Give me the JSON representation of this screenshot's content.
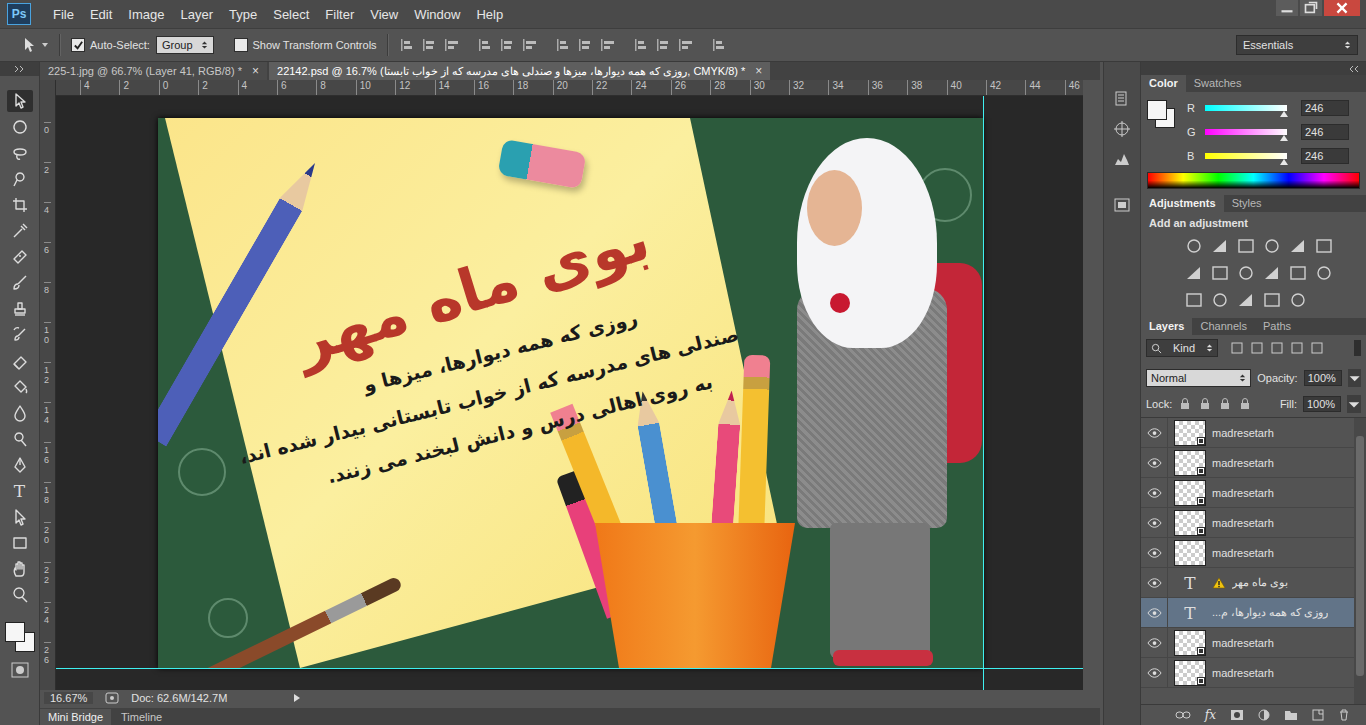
{
  "app": {
    "logo": "Ps"
  },
  "menu": [
    "File",
    "Edit",
    "Image",
    "Layer",
    "Type",
    "Select",
    "Filter",
    "View",
    "Window",
    "Help"
  ],
  "options_bar": {
    "auto_select": {
      "label": "Auto-Select:",
      "checked": true
    },
    "target": "Group",
    "transform_controls": {
      "label": "Show Transform Controls",
      "checked": false
    },
    "workspace": "Essentials"
  },
  "document_tabs": [
    {
      "label": "225-1.jpg @ 66.7% (Layer 41, RGB/8) *",
      "close": "×",
      "selected": false
    },
    {
      "label": "22142.psd @ 16.7% (روزی که همه دیوارها، میزها و  صندلی های مدرسه که از خواب تابستا, CMYK/8) *",
      "close": "×",
      "selected": true
    }
  ],
  "tools": [
    {
      "kind": "move",
      "selected": true
    },
    {
      "kind": "marquee",
      "selected": false
    },
    {
      "kind": "lasso",
      "selected": false
    },
    {
      "kind": "quick-select",
      "selected": false
    },
    {
      "kind": "crop",
      "selected": false
    },
    {
      "kind": "eyedropper",
      "selected": false
    },
    {
      "kind": "heal",
      "selected": false
    },
    {
      "kind": "brush",
      "selected": false
    },
    {
      "kind": "stamp",
      "selected": false
    },
    {
      "kind": "history",
      "selected": false
    },
    {
      "kind": "eraser",
      "selected": false
    },
    {
      "kind": "bucket",
      "selected": false
    },
    {
      "kind": "blur",
      "selected": false
    },
    {
      "kind": "dodge",
      "selected": false
    },
    {
      "kind": "pen",
      "selected": false
    },
    {
      "kind": "type",
      "label": "T",
      "selected": false
    },
    {
      "kind": "path-select",
      "selected": false
    },
    {
      "kind": "shape",
      "selected": false
    },
    {
      "kind": "hand",
      "selected": false
    },
    {
      "kind": "zoom",
      "selected": false
    }
  ],
  "rulers": {
    "top": [
      "4",
      "2",
      "0",
      "2",
      "4",
      "6",
      "8",
      "10",
      "12",
      "14",
      "16",
      "18",
      "20",
      "22",
      "24",
      "26",
      "28",
      "30",
      "32",
      "34",
      "36",
      "38",
      "40",
      "42",
      "44",
      "46"
    ],
    "left": [
      "0",
      "2",
      "4",
      "6",
      "8",
      "10",
      "12",
      "14",
      "16",
      "18",
      "20",
      "22",
      "24",
      "26"
    ]
  },
  "poster": {
    "title": "بوی ماه مهر",
    "lines": [
      "روزی که همه دیوارها، میزها و",
      "صندلی های مدرسه که از خواب تابستانی بیدار شده اند،",
      "به روی اهالی درس و دانش لبخند می زنند."
    ]
  },
  "status_bar": {
    "zoom": "16.67%",
    "doc": "Doc: 62.6M/142.7M"
  },
  "bottom_tabs": [
    {
      "label": "Mini Bridge",
      "selected": true
    },
    {
      "label": "Timeline",
      "selected": false
    }
  ],
  "color_panel": {
    "tabs": [
      {
        "label": "Color",
        "selected": true
      },
      {
        "label": "Swatches",
        "selected": false
      }
    ],
    "channels": [
      {
        "name": "R",
        "value": "246",
        "level": 0.965,
        "color": "#00ffff"
      },
      {
        "name": "G",
        "value": "246",
        "level": 0.965,
        "color": "#ff00ff"
      },
      {
        "name": "B",
        "value": "246",
        "level": 0.965,
        "color": "#ffff00"
      }
    ]
  },
  "adjustments_panel": {
    "tabs": [
      {
        "label": "Adjustments",
        "selected": true
      },
      {
        "label": "Styles",
        "selected": false
      }
    ],
    "hint": "Add an adjustment"
  },
  "layers_panel": {
    "tabs": [
      {
        "label": "Layers",
        "selected": true
      },
      {
        "label": "Channels",
        "selected": false
      },
      {
        "label": "Paths",
        "selected": false
      }
    ],
    "filter": "Kind",
    "blend_mode": "Normal",
    "opacity_label": "Opacity:",
    "opacity": "100%",
    "lock_label": "Lock:",
    "fill_label": "Fill:",
    "fill": "100%",
    "fx": "fx",
    "layers": [
      {
        "name": "madresetarh",
        "kind": "smart",
        "visible": true,
        "selected": false,
        "warning": false
      },
      {
        "name": "madresetarh",
        "kind": "smart",
        "visible": true,
        "selected": false,
        "warning": false
      },
      {
        "name": "madresetarh",
        "kind": "smart",
        "visible": true,
        "selected": false,
        "warning": false
      },
      {
        "name": "madresetarh",
        "kind": "smart",
        "visible": true,
        "selected": false,
        "warning": false
      },
      {
        "name": "madresetarh",
        "kind": "raster",
        "visible": true,
        "selected": false,
        "warning": false
      },
      {
        "name": "بوی ماه مهر",
        "kind": "text",
        "thumb": "T",
        "visible": true,
        "selected": false,
        "warning": true
      },
      {
        "name": "روزی که همه دیوارها، م...",
        "kind": "text",
        "thumb": "T",
        "visible": true,
        "selected": true,
        "warning": false
      },
      {
        "name": "madresetarh",
        "kind": "smart",
        "visible": true,
        "selected": false,
        "warning": false
      },
      {
        "name": "madresetarh",
        "kind": "smart",
        "visible": true,
        "selected": false,
        "warning": false
      }
    ]
  }
}
